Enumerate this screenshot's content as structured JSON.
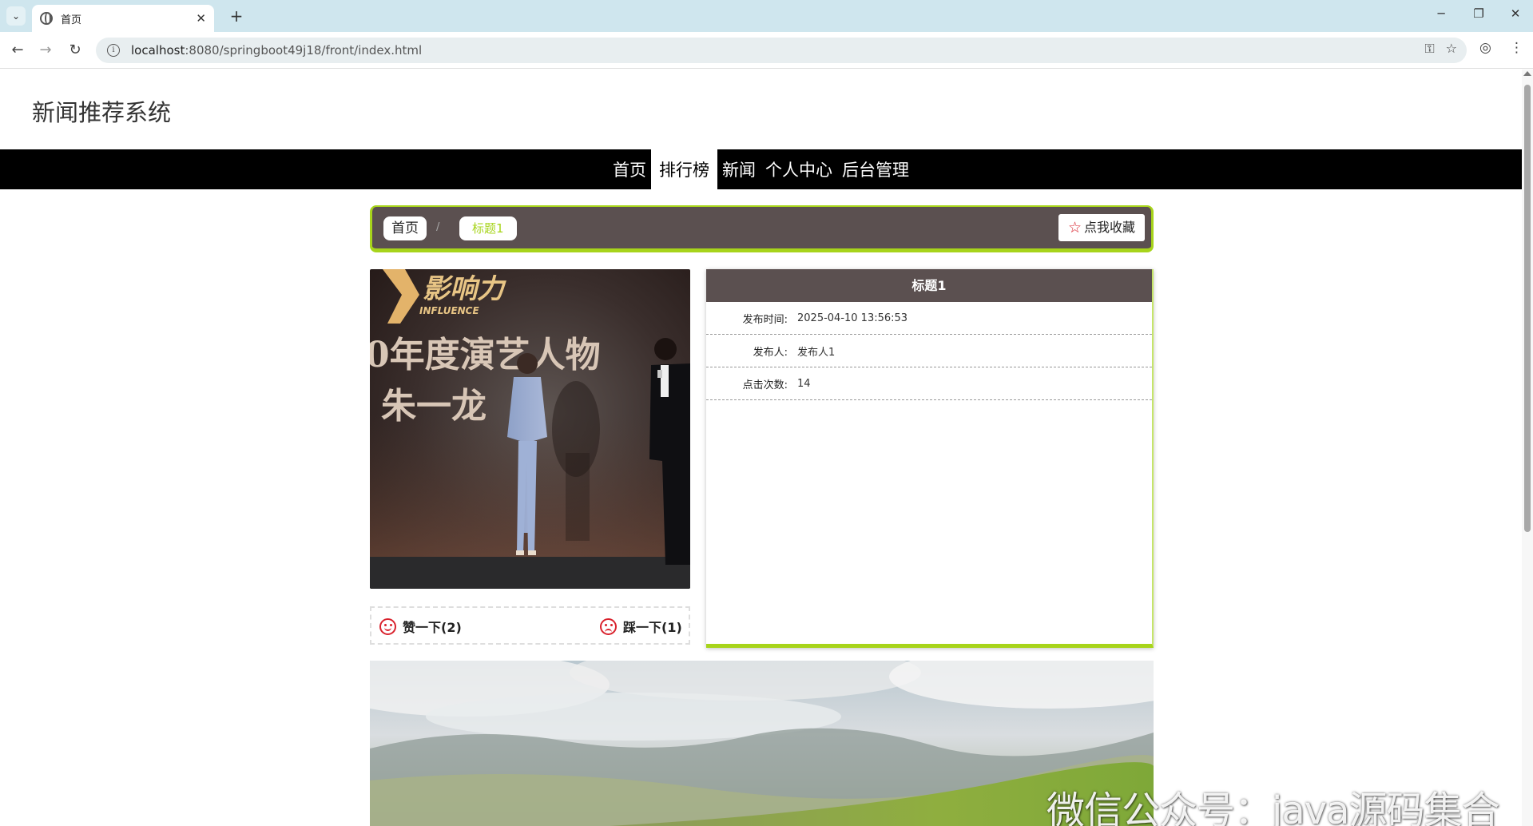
{
  "browser": {
    "tab_title": "首页",
    "url_host": "localhost",
    "url_path": ":8080/springboot49j18/front/index.html"
  },
  "site": {
    "title": "新闻推荐系统"
  },
  "nav": {
    "items": [
      "首页",
      "排行榜",
      "新闻",
      "个人中心",
      "后台管理"
    ],
    "active": "排行榜"
  },
  "breadcrumb": {
    "home": "首页",
    "separator": "/",
    "current": "标题1",
    "favorite_label": "点我收藏"
  },
  "news_image": {
    "banner_text": "影响力",
    "banner_subtext": "INFLUENCE",
    "stage_text_1": "0年度演艺人物",
    "stage_text_2": "朱一龙"
  },
  "votes": {
    "like_label": "赞一下(2)",
    "dislike_label": "踩一下(1)"
  },
  "detail": {
    "title": "标题1",
    "rows": [
      {
        "label": "发布时间:",
        "value": "2025-04-10 13:56:53"
      },
      {
        "label": "发布人:",
        "value": "发布人1"
      },
      {
        "label": "点击次数:",
        "value": "14"
      }
    ]
  },
  "watermark": "微信公众号：java源码集合",
  "colors": {
    "accent": "#a7d41b",
    "panel_dark": "#5b5050",
    "nav_bg": "#000000",
    "icon_red": "#d9232e"
  }
}
